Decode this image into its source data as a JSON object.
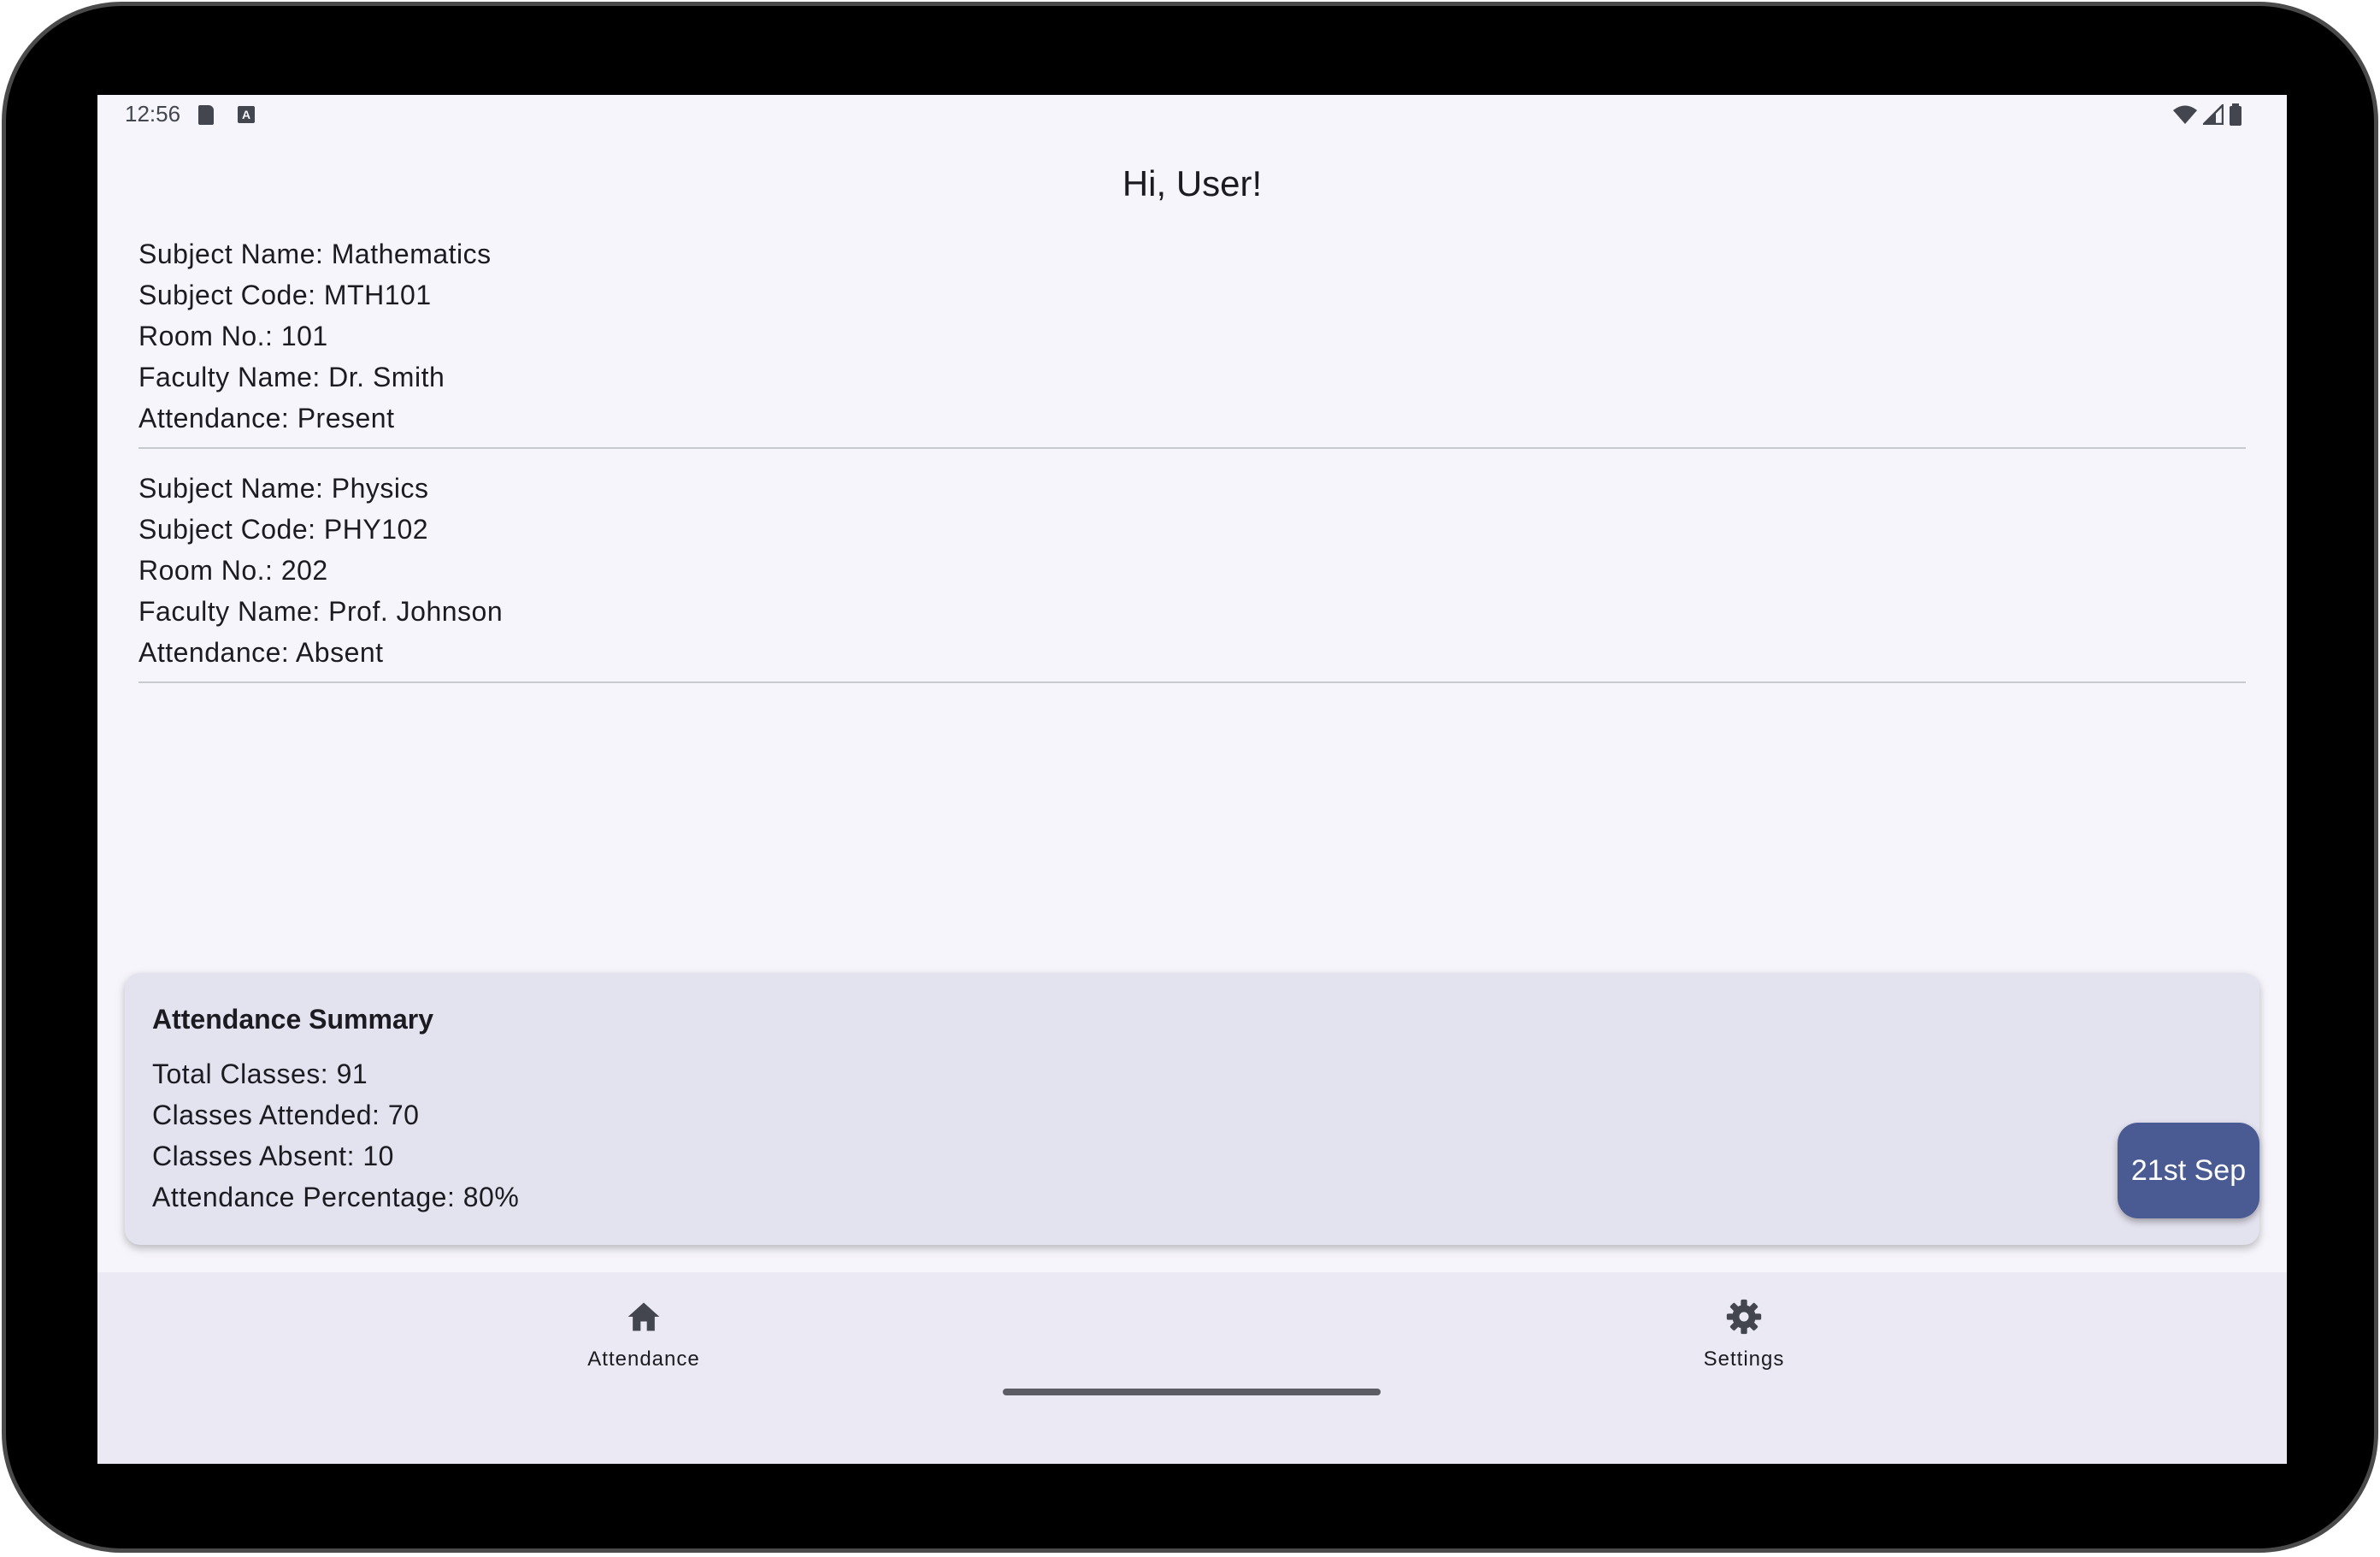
{
  "status_bar": {
    "time": "12:56",
    "icons": [
      "sd-card-icon",
      "a-notification-icon",
      "wifi-icon",
      "signal-icon",
      "battery-icon"
    ]
  },
  "greeting": "Hi, User!",
  "subjects": [
    {
      "name": "Subject Name: Mathematics",
      "code": "Subject Code: MTH101",
      "room": "Room No.: 101",
      "faculty": "Faculty Name: Dr. Smith",
      "attendance": "Attendance: Present"
    },
    {
      "name": "Subject Name: Physics",
      "code": "Subject Code: PHY102",
      "room": "Room No.: 202",
      "faculty": "Faculty Name: Prof. Johnson",
      "attendance": "Attendance: Absent"
    }
  ],
  "summary": {
    "title": "Attendance Summary",
    "total": "Total Classes: 91",
    "attended": "Classes Attended: 70",
    "absent": "Classes Absent: 10",
    "percentage": "Attendance Percentage: 80%"
  },
  "date_button": "21st Sep",
  "bottom_nav": {
    "items": [
      {
        "label": "Attendance",
        "icon": "home-icon"
      },
      {
        "label": "Settings",
        "icon": "gear-icon"
      }
    ]
  },
  "colors": {
    "background": "#f6f5fb",
    "summary_card": "#e3e2ef",
    "accent": "#4a5b93",
    "nav_background": "#ebeaf4"
  }
}
